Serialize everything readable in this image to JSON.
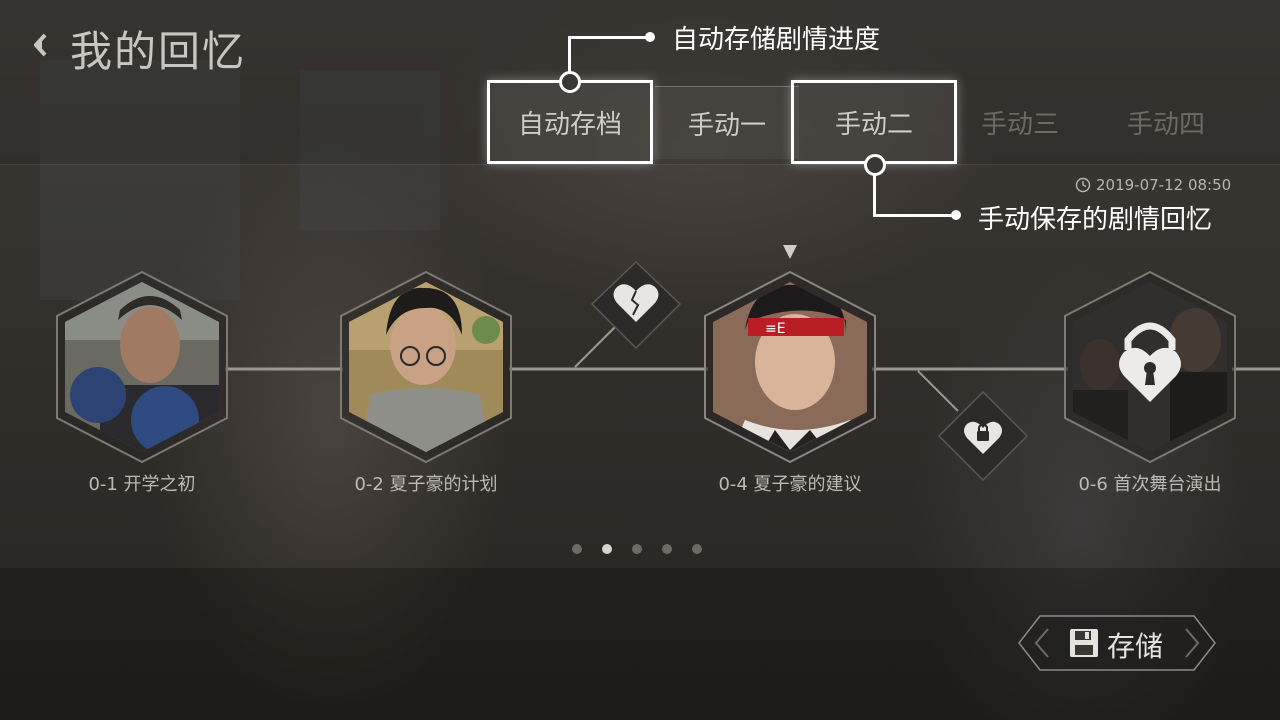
{
  "header": {
    "title": "我的回忆"
  },
  "tabs": [
    {
      "label": "自动存档",
      "state": "highlighted"
    },
    {
      "label": "手动一",
      "state": "normal"
    },
    {
      "label": "手动二",
      "state": "highlighted"
    },
    {
      "label": "手动三",
      "state": "dim"
    },
    {
      "label": "手动四",
      "state": "dim"
    }
  ],
  "callouts": {
    "auto_save": "自动存储剧情进度",
    "manual_save": "手动保存的剧情回忆"
  },
  "timestamp": "2019-07-12  08:50",
  "memories": [
    {
      "label": "0-1 开学之初",
      "locked": false
    },
    {
      "label": "0-2 夏子豪的计划",
      "locked": false
    },
    {
      "label": "0-4 夏子豪的建议",
      "locked": false,
      "selected": true
    },
    {
      "label": "0-6 首次舞台演出",
      "locked": true
    }
  ],
  "branch_nodes": [
    {
      "icon": "broken-heart-icon"
    },
    {
      "icon": "locked-heart-icon"
    }
  ],
  "pagination": {
    "total": 5,
    "active": 2
  },
  "save_button": {
    "label": "存储",
    "icon": "floppy-disk-icon"
  },
  "colors": {
    "accent": "#ffffff",
    "node_bg": "#2b2a28"
  }
}
